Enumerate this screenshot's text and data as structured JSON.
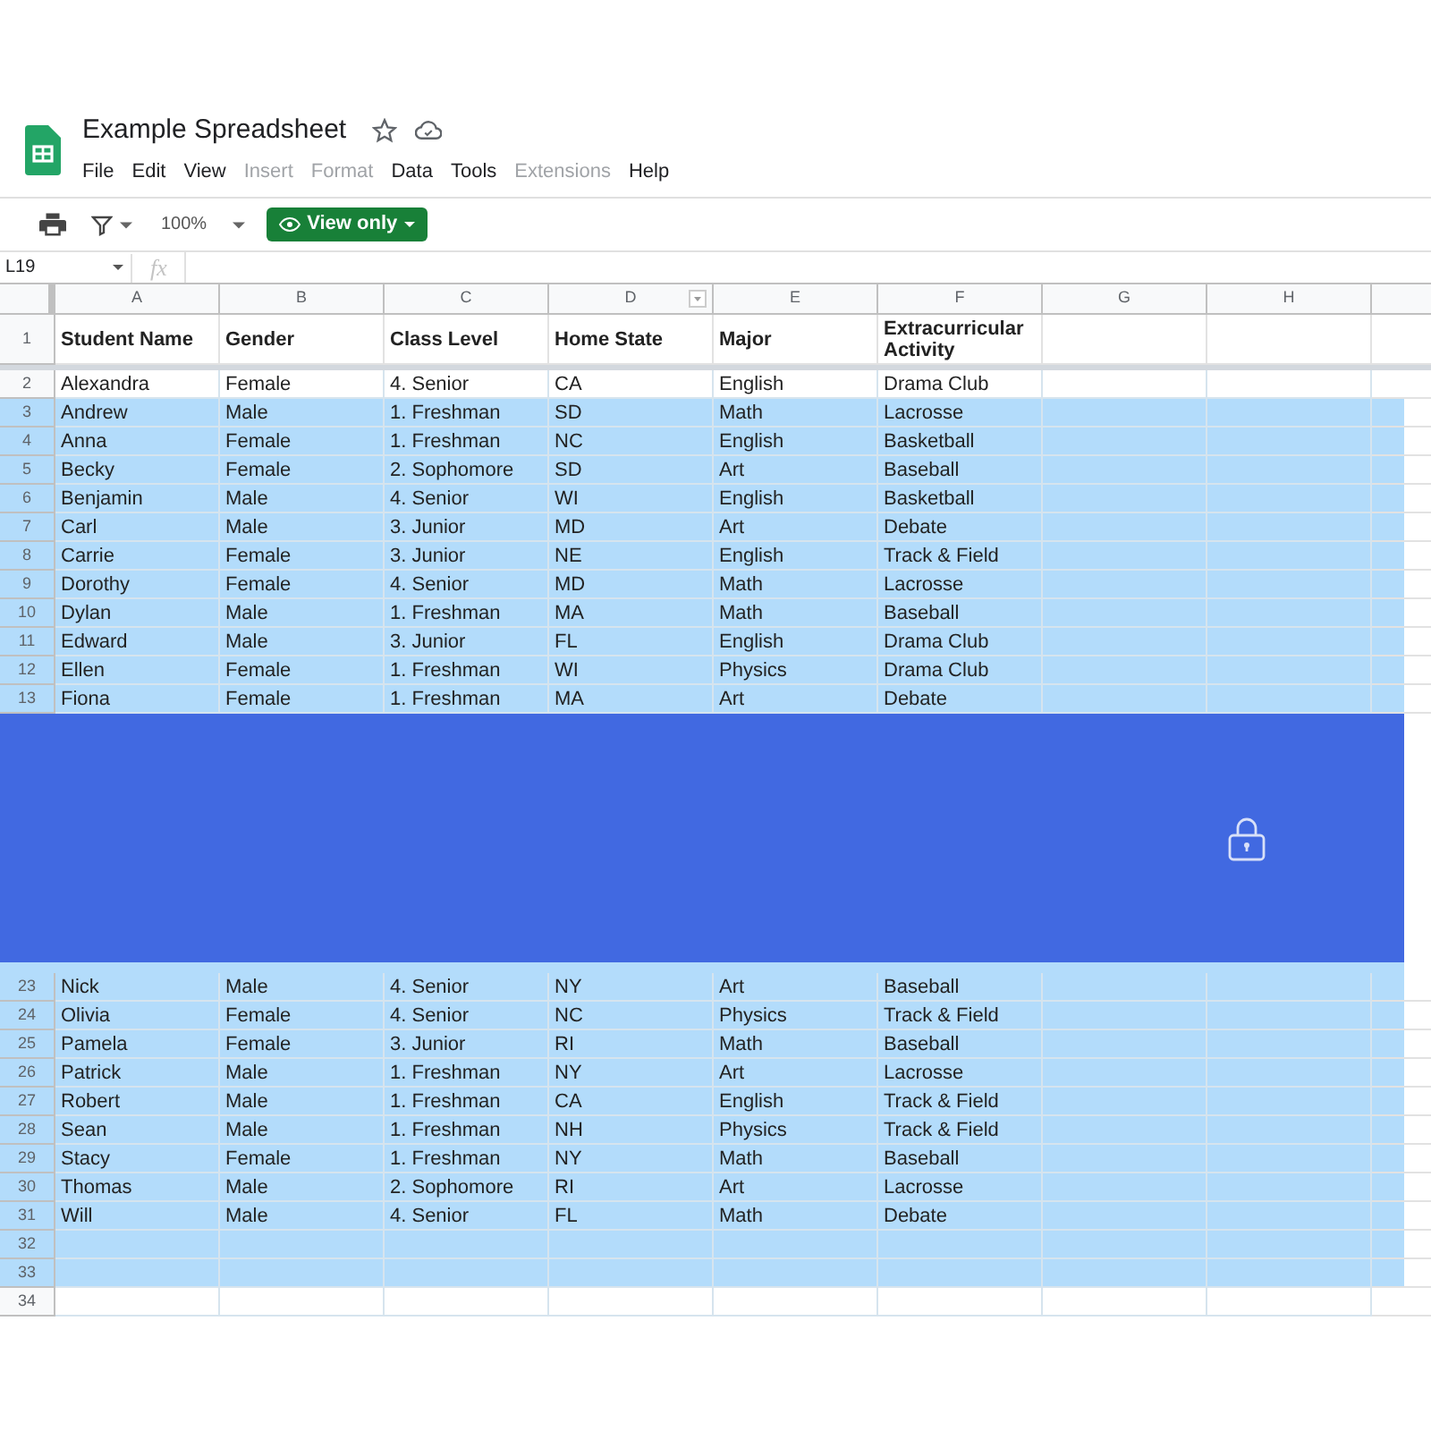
{
  "document": {
    "title": "Example Spreadsheet"
  },
  "menu": [
    {
      "label": "File",
      "disabled": false
    },
    {
      "label": "Edit",
      "disabled": false
    },
    {
      "label": "View",
      "disabled": false
    },
    {
      "label": "Insert",
      "disabled": true
    },
    {
      "label": "Format",
      "disabled": true
    },
    {
      "label": "Data",
      "disabled": false
    },
    {
      "label": "Tools",
      "disabled": false
    },
    {
      "label": "Extensions",
      "disabled": true
    },
    {
      "label": "Help",
      "disabled": false
    }
  ],
  "toolbar": {
    "zoom": "100%",
    "mode_button": "View only"
  },
  "formula_bar": {
    "cell_reference": "L19",
    "fx": "fx"
  },
  "columns": [
    {
      "label": "A",
      "filter": false
    },
    {
      "label": "B",
      "filter": false
    },
    {
      "label": "C",
      "filter": false
    },
    {
      "label": "D",
      "filter": true
    },
    {
      "label": "E",
      "filter": false
    },
    {
      "label": "F",
      "filter": false
    },
    {
      "label": "G",
      "filter": false
    },
    {
      "label": "H",
      "filter": false
    }
  ],
  "header_row": {
    "number": "1",
    "cells": [
      "Student Name",
      "Gender",
      "Class Level",
      "Home State",
      "Major",
      "Extracurricular Activity"
    ]
  },
  "rows_top": [
    {
      "number": "2",
      "highlighted": false,
      "cells": [
        "Alexandra",
        "Female",
        "4. Senior",
        "CA",
        "English",
        "Drama Club"
      ]
    },
    {
      "number": "3",
      "highlighted": true,
      "cells": [
        "Andrew",
        "Male",
        "1. Freshman",
        "SD",
        "Math",
        "Lacrosse"
      ]
    },
    {
      "number": "4",
      "highlighted": true,
      "cells": [
        "Anna",
        "Female",
        "1. Freshman",
        "NC",
        "English",
        "Basketball"
      ]
    },
    {
      "number": "5",
      "highlighted": true,
      "cells": [
        "Becky",
        "Female",
        "2. Sophomore",
        "SD",
        "Art",
        "Baseball"
      ]
    },
    {
      "number": "6",
      "highlighted": true,
      "cells": [
        "Benjamin",
        "Male",
        "4. Senior",
        "WI",
        "English",
        "Basketball"
      ]
    },
    {
      "number": "7",
      "highlighted": true,
      "cells": [
        "Carl",
        "Male",
        "3. Junior",
        "MD",
        "Art",
        "Debate"
      ]
    },
    {
      "number": "8",
      "highlighted": true,
      "cells": [
        "Carrie",
        "Female",
        "3. Junior",
        "NE",
        "English",
        "Track & Field"
      ]
    },
    {
      "number": "9",
      "highlighted": true,
      "cells": [
        "Dorothy",
        "Female",
        "4. Senior",
        "MD",
        "Math",
        "Lacrosse"
      ]
    },
    {
      "number": "10",
      "highlighted": true,
      "cells": [
        "Dylan",
        "Male",
        "1. Freshman",
        "MA",
        "Math",
        "Baseball"
      ]
    },
    {
      "number": "11",
      "highlighted": true,
      "cells": [
        "Edward",
        "Male",
        "3. Junior",
        "FL",
        "English",
        "Drama Club"
      ]
    },
    {
      "number": "12",
      "highlighted": true,
      "cells": [
        "Ellen",
        "Female",
        "1. Freshman",
        "WI",
        "Physics",
        "Drama Club"
      ]
    },
    {
      "number": "13",
      "highlighted": true,
      "cells": [
        "Fiona",
        "Female",
        "1. Freshman",
        "MA",
        "Art",
        "Debate"
      ]
    }
  ],
  "rows_bottom": [
    {
      "number": "23",
      "highlighted": true,
      "cells": [
        "Nick",
        "Male",
        "4. Senior",
        "NY",
        "Art",
        "Baseball"
      ]
    },
    {
      "number": "24",
      "highlighted": true,
      "cells": [
        "Olivia",
        "Female",
        "4. Senior",
        "NC",
        "Physics",
        "Track & Field"
      ]
    },
    {
      "number": "25",
      "highlighted": true,
      "cells": [
        "Pamela",
        "Female",
        "3. Junior",
        "RI",
        "Math",
        "Baseball"
      ]
    },
    {
      "number": "26",
      "highlighted": true,
      "cells": [
        "Patrick",
        "Male",
        "1. Freshman",
        "NY",
        "Art",
        "Lacrosse"
      ]
    },
    {
      "number": "27",
      "highlighted": true,
      "cells": [
        "Robert",
        "Male",
        "1. Freshman",
        "CA",
        "English",
        "Track & Field"
      ]
    },
    {
      "number": "28",
      "highlighted": true,
      "cells": [
        "Sean",
        "Male",
        "1. Freshman",
        "NH",
        "Physics",
        "Track & Field"
      ]
    },
    {
      "number": "29",
      "highlighted": true,
      "cells": [
        "Stacy",
        "Female",
        "1. Freshman",
        "NY",
        "Math",
        "Baseball"
      ]
    },
    {
      "number": "30",
      "highlighted": true,
      "cells": [
        "Thomas",
        "Male",
        "2. Sophomore",
        "RI",
        "Art",
        "Lacrosse"
      ]
    },
    {
      "number": "31",
      "highlighted": true,
      "cells": [
        "Will",
        "Male",
        "4. Senior",
        "FL",
        "Math",
        "Debate"
      ]
    },
    {
      "number": "32",
      "highlighted": true
    },
    {
      "number": "33",
      "highlighted": true
    },
    {
      "number": "34",
      "highlighted": false
    }
  ]
}
